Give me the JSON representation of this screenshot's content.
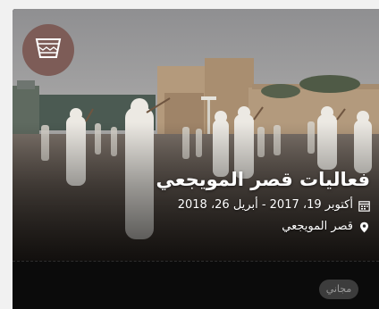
{
  "event": {
    "title": "فعاليات قصر المويجعي",
    "date_range": "أكتوبر 19، 2017 - أبريل 26، 2018",
    "location": "قصر المويجعي",
    "price": "مجاني"
  },
  "icons": {
    "category": "basket-icon",
    "date": "calendar-icon",
    "location": "map-pin-icon"
  },
  "colors": {
    "card_background": "#0b0b0b",
    "badge": "#7d5c57",
    "price_pill": "#3c3c3c"
  }
}
